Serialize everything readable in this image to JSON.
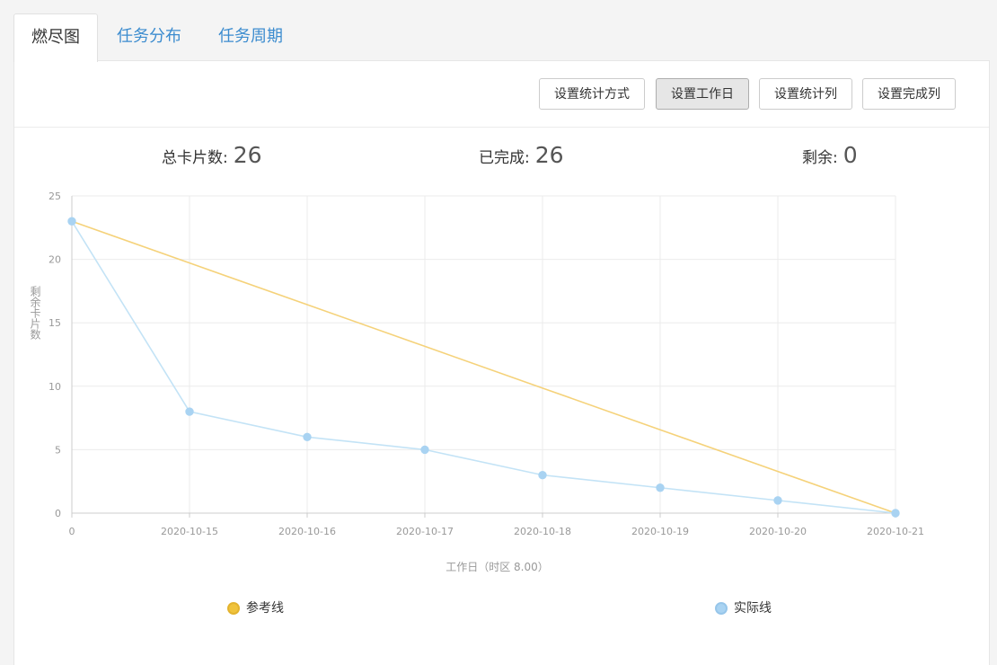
{
  "tabs": [
    {
      "label": "燃尽图",
      "active": true
    },
    {
      "label": "任务分布",
      "active": false
    },
    {
      "label": "任务周期",
      "active": false
    }
  ],
  "toolbar": {
    "buttons": [
      {
        "label": "设置统计方式",
        "pressed": false
      },
      {
        "label": "设置工作日",
        "pressed": true
      },
      {
        "label": "设置统计列",
        "pressed": false
      },
      {
        "label": "设置完成列",
        "pressed": false
      }
    ]
  },
  "stats": {
    "total_label": "总卡片数:",
    "total_value": "26",
    "done_label": "已完成:",
    "done_value": "26",
    "remain_label": "剩余:",
    "remain_value": "0"
  },
  "chart_data": {
    "type": "line",
    "x": [
      "0",
      "2020-10-15",
      "2020-10-16",
      "2020-10-17",
      "2020-10-18",
      "2020-10-19",
      "2020-10-20",
      "2020-10-21"
    ],
    "series": [
      {
        "name": "参考线",
        "values": [
          23,
          19.714,
          16.429,
          13.143,
          9.857,
          6.571,
          3.286,
          0
        ],
        "color": "#f5d27a",
        "legend_color": "#f0c33c",
        "markers": false
      },
      {
        "name": "实际线",
        "values": [
          23,
          8,
          6,
          5,
          3,
          2,
          1,
          0
        ],
        "color": "#c3e3f6",
        "legend_color": "#a9d3f2",
        "markers": true
      }
    ],
    "xlabel": "工作日（时区 8.00）",
    "ylabel": "剩余卡片数",
    "ylim": [
      0,
      25
    ],
    "yticks": [
      0,
      5,
      10,
      15,
      20,
      25
    ],
    "grid": true,
    "legend_position": "bottom"
  }
}
